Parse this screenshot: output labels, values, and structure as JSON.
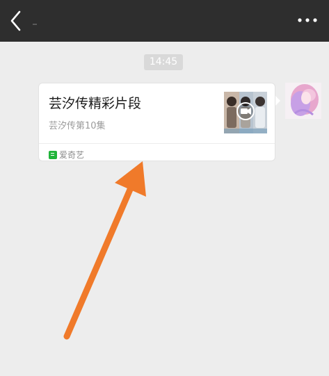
{
  "header": {
    "back_icon": "chevron-left-icon",
    "more_icon": "more-dots-icon"
  },
  "chat": {
    "timestamp": "14:45",
    "message": {
      "title": "芸汐传精彩片段",
      "description": "芸汐传第10集",
      "source_label": "爱奇艺",
      "source_icon": "iqiyi-icon",
      "thumbnail_icon": "video-camera-icon"
    }
  },
  "colors": {
    "topbar": "#2e2e2e",
    "background": "#ededed",
    "arrow": "#f07a2a",
    "source_icon": "#21b43a"
  }
}
